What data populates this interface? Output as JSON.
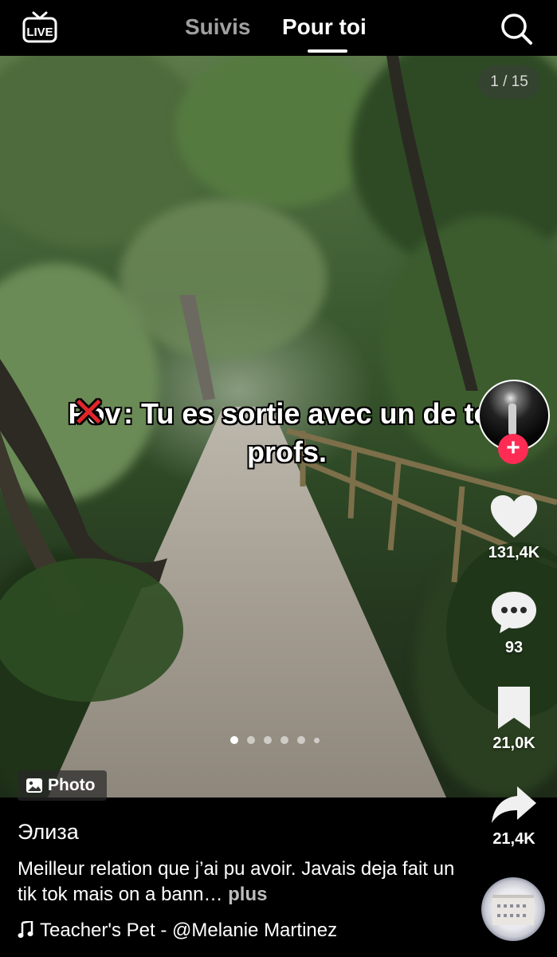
{
  "header": {
    "live_label": "LIVE",
    "tabs": [
      {
        "label": "Suivis",
        "active": false
      },
      {
        "label": "Pour toi",
        "active": true
      }
    ]
  },
  "post": {
    "image_counter": "1 / 15",
    "caption_crossed": "Pov",
    "caption_text": " : Tu es sortie avec un de tes profs.",
    "media_badge": "Photo",
    "carousel_dots": 6,
    "carousel_active_index": 0,
    "username": "Элиза",
    "description": "Meilleur relation que j’ai pu avoir.  Javais deja fait un tik tok mais on a bann…",
    "more_label": " plus",
    "music": "Teacher's Pet - @Melanie Martinez"
  },
  "actions": {
    "likes": "131,4K",
    "comments": "93",
    "saves": "21,0K",
    "shares": "21,4K"
  },
  "icons": {
    "live": "live-tv-icon",
    "search": "search-icon",
    "like": "heart-icon",
    "comment": "comment-bubble-icon",
    "save": "bookmark-icon",
    "share": "share-arrow-icon",
    "music": "music-note-icon",
    "photo": "image-icon"
  },
  "colors": {
    "follow_button": "#fe2c55",
    "cross_mark": "#e0262b",
    "inactive_tab": "#a0a0a0"
  }
}
